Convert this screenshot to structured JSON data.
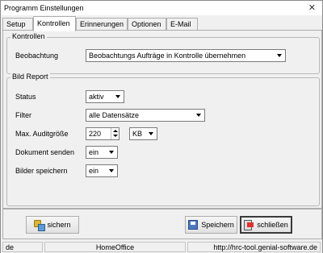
{
  "window": {
    "title": "Programm Einstellungen",
    "close_glyph": "✕"
  },
  "tabs": [
    {
      "label": "Setup"
    },
    {
      "label": "Kontrollen",
      "active": true
    },
    {
      "label": "Erinnerungen"
    },
    {
      "label": "Optionen"
    },
    {
      "label": "E-Mail"
    }
  ],
  "kontrollen_group": {
    "legend": "Kontrollen",
    "beobachtung_label": "Beobachtung",
    "beobachtung_value": "Beobachtungs Aufträge in Kontrolle übernehmen"
  },
  "bild_report_group": {
    "legend": "Bild Report",
    "status_label": "Status",
    "status_value": "aktiv",
    "filter_label": "Filter",
    "filter_value": "alle Datensätze",
    "audit_label": "Max. Auditgröße",
    "audit_value": "220",
    "audit_unit": "KB",
    "send_label": "Dokument senden",
    "send_value": "ein",
    "images_label": "Bilder speichern",
    "images_value": "ein"
  },
  "buttons": {
    "sichern": "sichern",
    "speichern": "Speichern",
    "schliessen": "schließen"
  },
  "statusbar": {
    "lang": "de",
    "location": "HomeOffice",
    "url": "http://hrc-tool.genial-software.de"
  },
  "icons": [
    "close-icon",
    "key-icon",
    "disk-icon",
    "exit-icon",
    "chevron-down-icon",
    "spin-up-icon",
    "spin-down-icon"
  ]
}
